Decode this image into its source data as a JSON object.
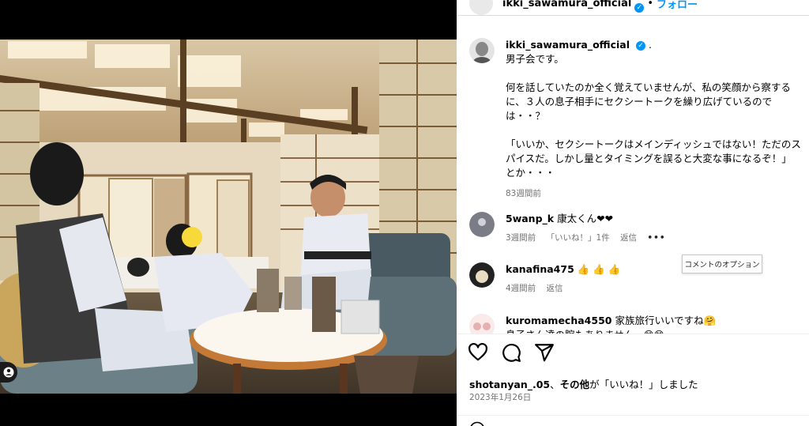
{
  "post": {
    "username": "ikki_sawamura_official",
    "separator": "•",
    "follow_label": "フォロー",
    "caption_username": "ikki_sawamura_official",
    "caption_suffix": ".",
    "caption_line1": "男子会です。",
    "caption_para2": "何を話していたのか全く覚えていませんが、私の笑顔から察するに、３人の息子相手にセクシートークを繰り広げているのでは・・？",
    "caption_para3": "「いいか、セクシートークはメインディッシュではない！ただのスパイスだ。しかし量とタイミングを誤ると大変な事になるぞ！」とか・・・",
    "caption_time": "83週間前"
  },
  "comments": [
    {
      "username": "5wanp_k",
      "text": "康太くん❤❤",
      "time": "3週間前",
      "likes": "「いいね！」1件",
      "reply": "返信",
      "more": "•••"
    },
    {
      "username": "kanafina475",
      "text": "👍 👍 👍",
      "time": "4週間前",
      "reply": "返信"
    },
    {
      "username": "kuromamecha4550",
      "text": "家族旅行いいですね🤗",
      "text2": "息子さん達の腕もありません…😊😊"
    }
  ],
  "tooltip": "コメントのオプション",
  "likes_line": {
    "user": "shotanyan_.05",
    "connector": "、",
    "others": "その他",
    "suffix": "が「いいね！」しました"
  },
  "post_date": "2023年1月26日",
  "icons": {
    "like": "heart-icon",
    "comment": "comment-icon",
    "share": "share-icon",
    "verified": "verified-badge-icon",
    "user_tag": "user-tag-icon"
  },
  "colors": {
    "accent": "#0095f6",
    "muted": "#737373"
  }
}
